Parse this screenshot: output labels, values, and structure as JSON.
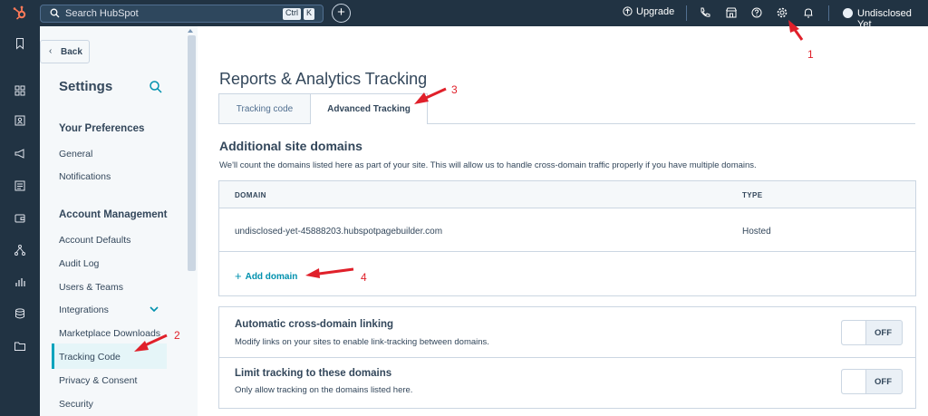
{
  "topbar": {
    "search_placeholder": "Search HubSpot",
    "kbd_ctrl": "Ctrl",
    "kbd_k": "K",
    "add_label": "+",
    "upgrade_label": "Upgrade",
    "user_name": "Undisclosed Yet"
  },
  "sidebar": {
    "back_label": "Back",
    "back_chevron": "‹",
    "title": "Settings",
    "sections": {
      "preferences": "Your Preferences",
      "account": "Account Management"
    },
    "items": {
      "general": "General",
      "notifications": "Notifications",
      "account_defaults": "Account Defaults",
      "audit_log": "Audit Log",
      "users_teams": "Users & Teams",
      "integrations": "Integrations",
      "marketplace": "Marketplace Downloads",
      "tracking_code": "Tracking Code",
      "privacy": "Privacy & Consent",
      "security": "Security"
    }
  },
  "main": {
    "page_title": "Reports & Analytics Tracking",
    "tabs": {
      "tracking_code": "Tracking code",
      "advanced": "Advanced Tracking"
    },
    "domains": {
      "heading": "Additional site domains",
      "description": "We'll count the domains listed here as part of your site. This will allow us to handle cross-domain traffic properly if you have multiple domains.",
      "col_domain": "DOMAIN",
      "col_type": "TYPE",
      "rows": [
        {
          "domain": "undisclosed-yet-45888203.hubspotpagebuilder.com",
          "type": "Hosted"
        }
      ],
      "add_plus": "+",
      "add_label": "Add domain"
    },
    "options": {
      "cross_domain": {
        "title": "Automatic cross-domain linking",
        "description": "Modify links on your sites to enable link-tracking between domains.",
        "state": "OFF"
      },
      "limit_tracking": {
        "title": "Limit tracking to these domains",
        "description": "Only allow tracking on the domains listed here.",
        "state": "OFF"
      }
    }
  },
  "annotations": {
    "n1": "1",
    "n2": "2",
    "n3": "3",
    "n4": "4"
  },
  "colors": {
    "topbar": "#213343",
    "accent": "#0091ae",
    "annotation": "#e0202a",
    "logo": "#ff7a59"
  },
  "icons": [
    "hubspot-logo-icon",
    "search-icon",
    "upgrade-icon",
    "phone-icon",
    "marketplace-icon",
    "help-icon",
    "gear-icon",
    "bell-icon",
    "bookmark-icon",
    "grid-icon",
    "contacts-icon",
    "megaphone-icon",
    "document-icon",
    "wallet-icon",
    "workflow-icon",
    "reports-icon",
    "database-icon",
    "folder-icon",
    "chevron-down-icon"
  ]
}
